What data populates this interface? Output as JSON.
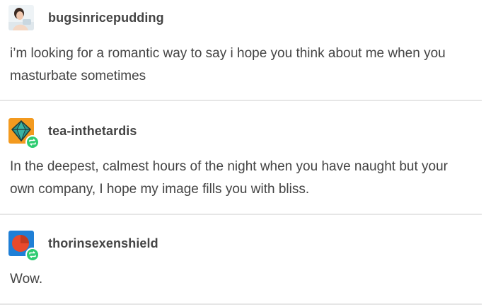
{
  "posts": [
    {
      "username": "bugsinricepudding",
      "avatar_icon": "woman-photo-avatar-icon",
      "reblogged": false,
      "text": "i’m looking for a romantic way to say i hope you think about me when you masturbate sometimes"
    },
    {
      "username": "tea-inthetardis",
      "avatar_icon": "orange-diamond-avatar-icon",
      "reblogged": true,
      "text": "In the deepest, calmest hours of the night when you have naught but your own company, I hope my image fills you with bliss."
    },
    {
      "username": "thorinsexenshield",
      "avatar_icon": "blue-circle-avatar-icon",
      "reblogged": true,
      "text": "Wow."
    }
  ],
  "colors": {
    "text": "#444444",
    "divider": "#e6e6e6",
    "reblog_badge": "#2ecc71"
  }
}
